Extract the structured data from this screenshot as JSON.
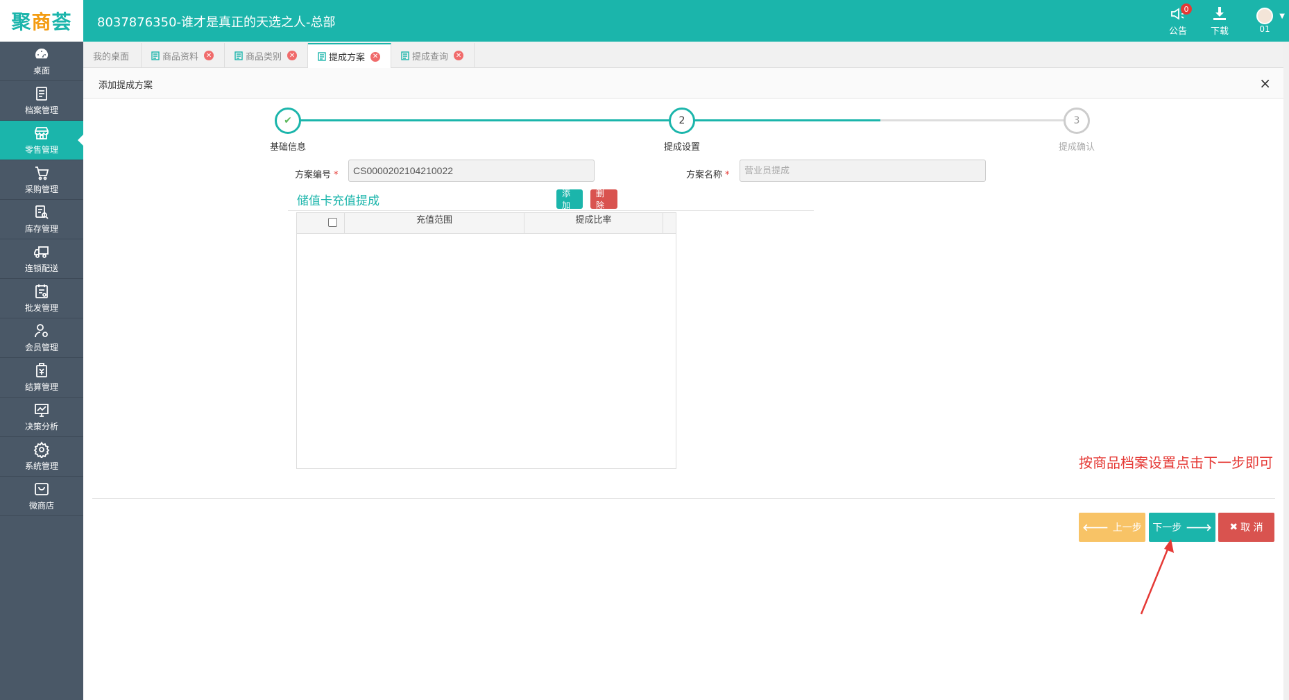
{
  "header": {
    "logo_text_1": "聚",
    "logo_text_2": "商",
    "logo_text_3": "荟",
    "title": "8037876350-谁才是真正的天选之人-总部",
    "notice_label": "公告",
    "notice_badge": "0",
    "download_label": "下载",
    "user_label": "01"
  },
  "sidebar": {
    "items": [
      {
        "label": "桌面",
        "icon": "dashboard-icon"
      },
      {
        "label": "档案管理",
        "icon": "archive-icon"
      },
      {
        "label": "零售管理",
        "icon": "store-icon"
      },
      {
        "label": "采购管理",
        "icon": "cart-icon"
      },
      {
        "label": "库存管理",
        "icon": "inventory-icon"
      },
      {
        "label": "连锁配送",
        "icon": "truck-icon"
      },
      {
        "label": "批发管理",
        "icon": "wholesale-icon"
      },
      {
        "label": "会员管理",
        "icon": "member-icon"
      },
      {
        "label": "结算管理",
        "icon": "settlement-icon"
      },
      {
        "label": "决策分析",
        "icon": "chart-icon"
      },
      {
        "label": "系统管理",
        "icon": "gear-icon"
      },
      {
        "label": "微商店",
        "icon": "shop-bag-icon"
      }
    ]
  },
  "tabs": [
    {
      "label": "我的桌面"
    },
    {
      "label": "商品资料"
    },
    {
      "label": "商品类别"
    },
    {
      "label": "提成方案"
    },
    {
      "label": "提成查询"
    }
  ],
  "panel": {
    "title": "添加提成方案",
    "close": "×"
  },
  "steps": [
    {
      "number": "✔",
      "label": "基础信息"
    },
    {
      "number": "2",
      "label": "提成设置"
    },
    {
      "number": "3",
      "label": "提成确认"
    }
  ],
  "form": {
    "code_label": "方案编号",
    "code_value": "CS0000202104210022",
    "name_label": "方案名称",
    "name_placeholder": "营业员提成",
    "required_mark": "*"
  },
  "section": {
    "title": "储值卡充值提成",
    "add_label": "添加",
    "delete_label": "删除"
  },
  "grid": {
    "columns": [
      "充值范围",
      "提成比率"
    ]
  },
  "annotation": "按商品档案设置点击下一步即可",
  "actions": {
    "prev_label": "上一步",
    "next_label": "下一步",
    "cancel_label": "取 消"
  },
  "colors": {
    "primary": "#1bb5ab",
    "sidebar": "#4a5867",
    "danger": "#d9534f",
    "warning": "#f7b94c",
    "annotation": "#e53935"
  }
}
